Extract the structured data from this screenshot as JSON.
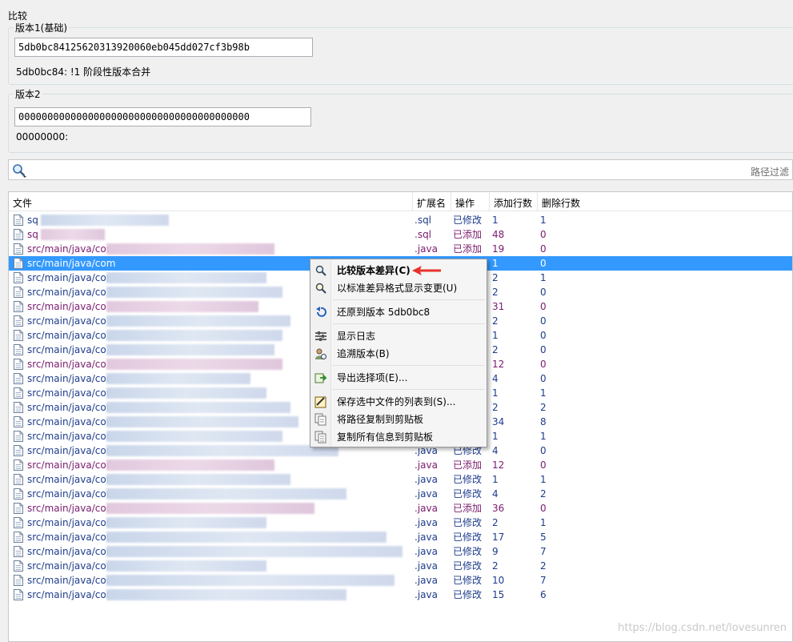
{
  "title": "比较",
  "base": {
    "legend": "版本1(基础)",
    "hash": "5db0bc84125620313920060eb045dd027cf3b98b",
    "message": "5db0bc84: !1 阶段性版本合并"
  },
  "compare": {
    "legend": "版本2",
    "hash": "0000000000000000000000000000000000000000",
    "message": "00000000:"
  },
  "filter": {
    "placeholder": "路径过滤",
    "icon": "search-icon"
  },
  "columns": [
    "文件",
    "扩展名",
    "操作",
    "添加行数",
    "删除行数"
  ],
  "rows": [
    {
      "file": "sq",
      "ext": ".sql",
      "op": "已修改",
      "add": "1",
      "del": "1",
      "kind": "mod"
    },
    {
      "file": "sq",
      "ext": ".sql",
      "op": "已添加",
      "add": "48",
      "del": "0",
      "kind": "add"
    },
    {
      "file": "src/main/java/com",
      "ext": ".java",
      "op": "已添加",
      "add": "19",
      "del": "0",
      "kind": "add"
    },
    {
      "file": "src/main/java/com",
      "ext": "",
      "op": "",
      "add": "1",
      "del": "0",
      "kind": "sel"
    },
    {
      "file": "src/main/java/com",
      "ext": "",
      "op": "",
      "add": "2",
      "del": "1",
      "kind": "mod"
    },
    {
      "file": "src/main/java/co",
      "ext": "",
      "op": "",
      "add": "2",
      "del": "0",
      "kind": "mod"
    },
    {
      "file": "src/main/java/co",
      "ext": "",
      "op": "",
      "add": "31",
      "del": "0",
      "kind": "add"
    },
    {
      "file": "src/main/java/co",
      "ext": "",
      "op": "",
      "add": "2",
      "del": "0",
      "kind": "mod"
    },
    {
      "file": "src/main/java/co",
      "ext": "",
      "op": "",
      "add": "1",
      "del": "0",
      "kind": "mod"
    },
    {
      "file": "src/main/java/co",
      "ext": "",
      "op": "",
      "add": "2",
      "del": "0",
      "kind": "mod"
    },
    {
      "file": "src/main/java/co",
      "ext": "",
      "op": "",
      "add": "12",
      "del": "0",
      "kind": "add"
    },
    {
      "file": "src/main/java/com",
      "ext": "",
      "op": "",
      "add": "4",
      "del": "0",
      "kind": "mod"
    },
    {
      "file": "src/main/java/com",
      "ext": "",
      "op": "",
      "add": "1",
      "del": "1",
      "kind": "mod"
    },
    {
      "file": "src/main/java/com",
      "ext": "",
      "op": "",
      "add": "2",
      "del": "2",
      "kind": "mod"
    },
    {
      "file": "src/main/java/com",
      "ext": "",
      "op": "",
      "add": "34",
      "del": "8",
      "kind": "mod"
    },
    {
      "file": "src/main/java/com",
      "ext": "",
      "op": "",
      "add": "1",
      "del": "1",
      "kind": "mod"
    },
    {
      "file": "src/main/java/com",
      "ext": ".java",
      "op": "已修改",
      "add": "4",
      "del": "0",
      "kind": "mod"
    },
    {
      "file": "src/main/java/com",
      "ext": ".java",
      "op": "已添加",
      "add": "12",
      "del": "0",
      "kind": "add"
    },
    {
      "file": "src/main/java/com",
      "ext": ".java",
      "op": "已修改",
      "add": "1",
      "del": "1",
      "kind": "mod"
    },
    {
      "file": "src/main/java/com",
      "ext": ".java",
      "op": "已修改",
      "add": "4",
      "del": "2",
      "kind": "mod"
    },
    {
      "file": "src/main/java/com",
      "ext": ".java",
      "op": "已添加",
      "add": "36",
      "del": "0",
      "kind": "add"
    },
    {
      "file": "src/main/java/com",
      "ext": ".java",
      "op": "已修改",
      "add": "2",
      "del": "1",
      "kind": "mod"
    },
    {
      "file": "src/main/java/com",
      "ext": ".java",
      "op": "已修改",
      "add": "17",
      "del": "5",
      "kind": "mod"
    },
    {
      "file": "src/main/java/com",
      "ext": ".java",
      "op": "已修改",
      "add": "9",
      "del": "7",
      "kind": "mod"
    },
    {
      "file": "src/main/java/com",
      "ext": ".java",
      "op": "已修改",
      "add": "2",
      "del": "2",
      "kind": "mod"
    },
    {
      "file": "src/main/java/com",
      "ext": ".java",
      "op": "已修改",
      "add": "10",
      "del": "7",
      "kind": "mod"
    },
    {
      "file": "src/main/java/com",
      "ext": ".java",
      "op": "已修改",
      "add": "15",
      "del": "6",
      "kind": "mod"
    }
  ],
  "context_menu": {
    "items": [
      {
        "label": "比较版本差异(C)",
        "icon": "magnifier-compare-icon",
        "bold": true
      },
      {
        "label": "以标准差异格式显示变更(U)",
        "icon": "magnifier-diff-icon"
      },
      {
        "label": "还原到版本 5db0bc8",
        "icon": "revert-arrow-icon"
      },
      {
        "label": "显示日志",
        "icon": "log-icon"
      },
      {
        "label": "追溯版本(B)",
        "icon": "blame-icon"
      },
      {
        "label": "导出选择项(E)...",
        "icon": "export-icon"
      },
      {
        "label": "保存选中文件的列表到(S)...",
        "icon": "save-list-icon"
      },
      {
        "label": "将路径复制到剪贴板",
        "icon": "copy-path-icon"
      },
      {
        "label": "复制所有信息到剪贴板",
        "icon": "copy-all-icon"
      }
    ]
  },
  "watermark": "https://blog.csdn.net/lovesunren",
  "colors": {
    "modified": "#1e3c8c",
    "added": "#7a1a6e",
    "selection": "#3399ff",
    "arrow": "#e8312a"
  }
}
